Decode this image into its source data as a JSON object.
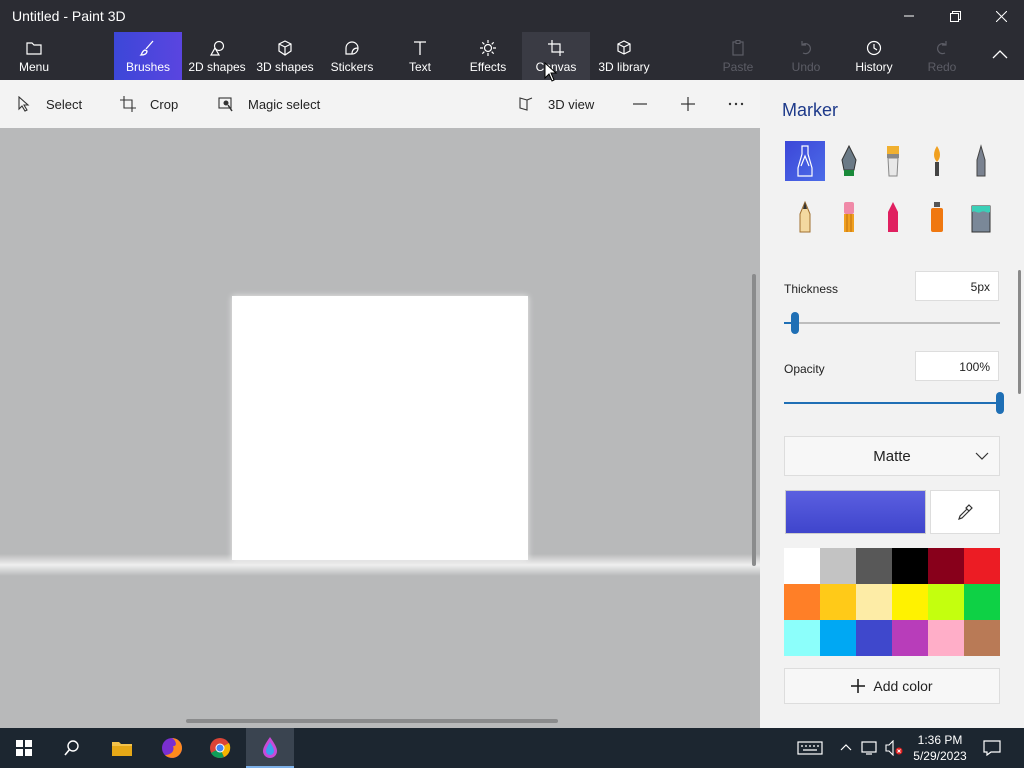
{
  "window": {
    "title": "Untitled - Paint 3D"
  },
  "ribbon": {
    "menu": "Menu",
    "tabs": [
      "Brushes",
      "2D shapes",
      "3D shapes",
      "Stickers",
      "Text",
      "Effects",
      "Canvas",
      "3D library"
    ],
    "active_tab": "Brushes",
    "actions": {
      "paste": "Paste",
      "undo": "Undo",
      "history": "History",
      "redo": "Redo"
    }
  },
  "toolbar": {
    "select": "Select",
    "crop": "Crop",
    "magic_select": "Magic select",
    "view3d": "3D view"
  },
  "panel": {
    "title": "Marker",
    "brushes": [
      "marker-icon",
      "calligraphy-pen-icon",
      "oil-brush-icon",
      "watercolor-icon",
      "pixel-pen-icon",
      "pencil-icon",
      "eraser-icon",
      "crayon-icon",
      "spray-can-icon",
      "fill-icon"
    ],
    "thickness_label": "Thickness",
    "thickness_value": "5px",
    "thickness_level": 0.05,
    "opacity_label": "Opacity",
    "opacity_value": "100%",
    "opacity_level": 1.0,
    "finish": "Matte",
    "current_color": "#3f45cc",
    "palette": [
      "#ffffff",
      "#c3c3c3",
      "#585858",
      "#000000",
      "#88001b",
      "#ec1c24",
      "#ff7f27",
      "#ffca18",
      "#fdeca6",
      "#fff200",
      "#c4ff0e",
      "#0ed145",
      "#8cfffb",
      "#00a8f3",
      "#3f48cc",
      "#b83dba",
      "#ffaec8",
      "#b97a56"
    ],
    "add_color": "Add color"
  },
  "taskbar": {
    "time": "1:36 PM",
    "date": "5/29/2023"
  }
}
